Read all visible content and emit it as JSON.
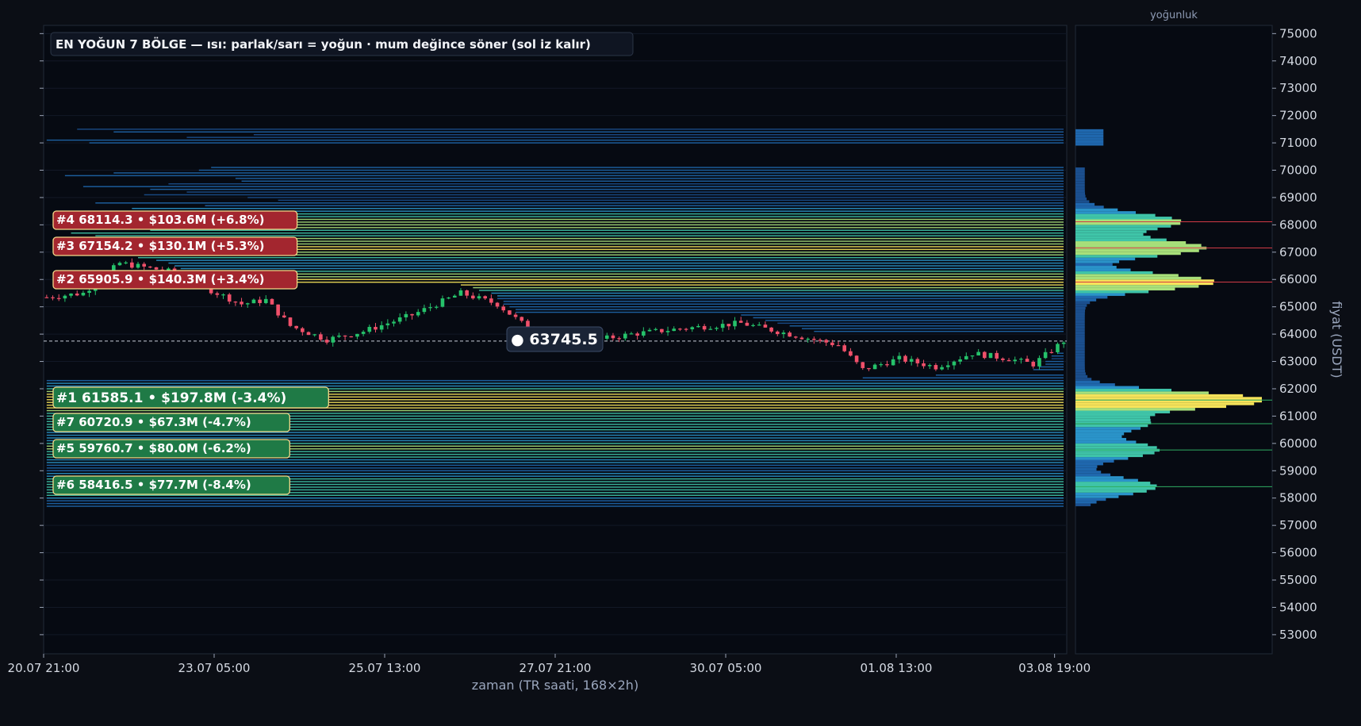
{
  "chart_data": {
    "type": "heatmap",
    "title": "EN YOĞUN 7 BÖLGE — ısı: parlak/sarı = yoğun · mum değince söner (sol iz kalır)",
    "xlabel": "zaman (TR saati, 168×2h)",
    "ylabel": "fiyat (USDT)",
    "profile_label": "yoğunluk",
    "x_ticks": [
      "20.07 21:00",
      "23.07 05:00",
      "25.07 13:00",
      "27.07 21:00",
      "30.07 05:00",
      "01.08 13:00",
      "03.08 19:00"
    ],
    "y_ticks": [
      53000,
      54000,
      55000,
      56000,
      57000,
      58000,
      59000,
      60000,
      61000,
      62000,
      63000,
      64000,
      65000,
      66000,
      67000,
      68000,
      69000,
      70000,
      71000,
      72000,
      73000,
      74000,
      75000
    ],
    "ylim": [
      52300,
      75300
    ],
    "n_candles": 168,
    "current_price": 63745.5,
    "current_price_label": "● 63745.5",
    "zones": [
      {
        "rank": "#4",
        "price": "68114.3",
        "value": "$103.6M",
        "pct": "(+6.8%)",
        "side": "above",
        "y": 68114.3
      },
      {
        "rank": "#3",
        "price": "67154.2",
        "value": "$130.1M",
        "pct": "(+5.3%)",
        "side": "above",
        "y": 67154.2
      },
      {
        "rank": "#2",
        "price": "65905.9",
        "value": "$140.3M",
        "pct": "(+3.4%)",
        "side": "above",
        "y": 65905.9
      },
      {
        "rank": "#1",
        "price": "61585.1",
        "value": "$197.8M",
        "pct": "(-3.4%)",
        "side": "below",
        "y": 61585.1
      },
      {
        "rank": "#7",
        "price": "60720.9",
        "value": "$67.3M",
        "pct": "(-4.7%)",
        "side": "below",
        "y": 60720.9
      },
      {
        "rank": "#5",
        "price": "59760.7",
        "value": "$80.0M",
        "pct": "(-6.2%)",
        "side": "below",
        "y": 59760.7
      },
      {
        "rank": "#6",
        "price": "58416.5",
        "value": "$77.7M",
        "pct": "(-8.4%)",
        "side": "below",
        "y": 58416.5
      }
    ],
    "colors": {
      "above": "#a3262f",
      "below": "#1f7a46",
      "up": "#25c26a",
      "down": "#f0506a",
      "hot": "#f6e35a",
      "cold": "#1b4f8e"
    }
  }
}
